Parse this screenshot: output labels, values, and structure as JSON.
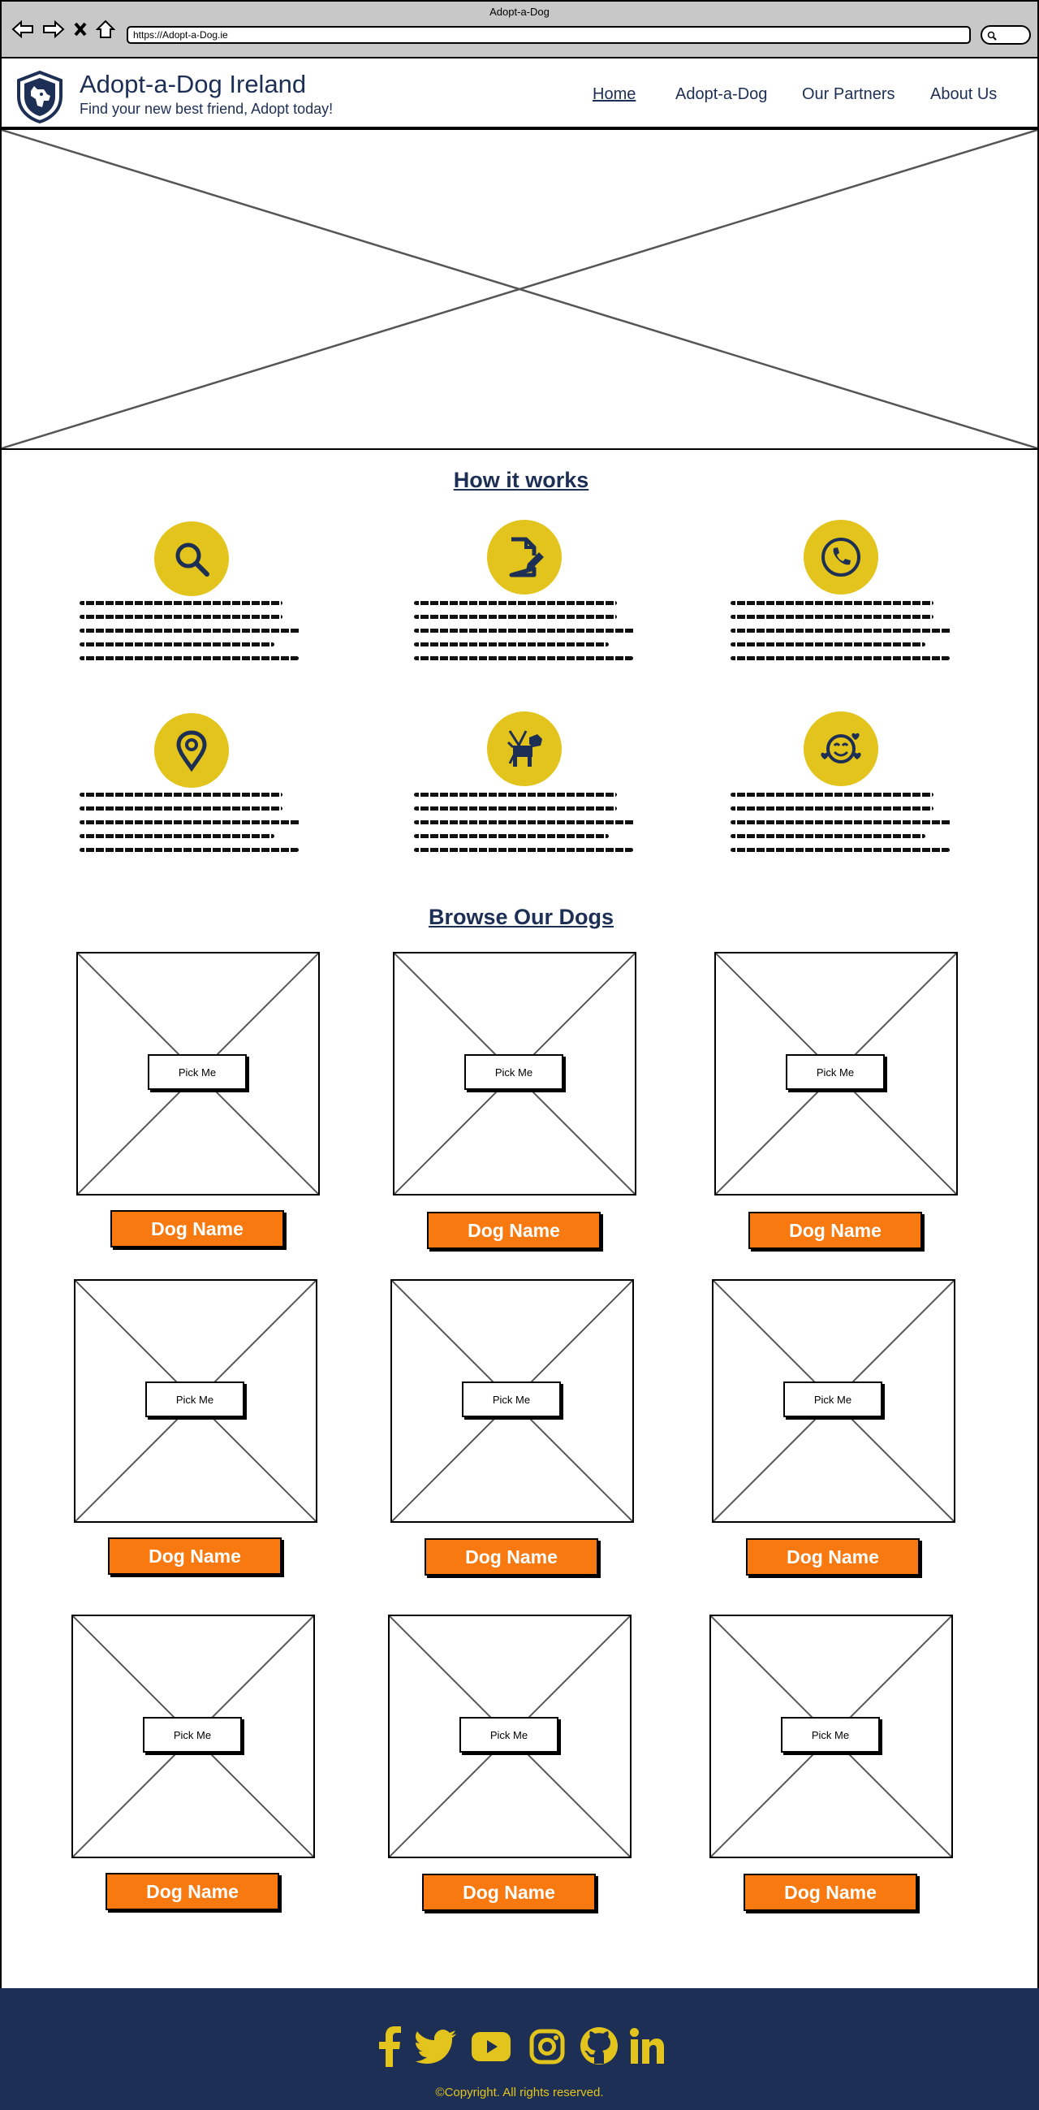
{
  "browser": {
    "window_title": "Adopt-a-Dog",
    "url": "https://Adopt-a-Dog.ie"
  },
  "header": {
    "title": "Adopt-a-Dog Ireland",
    "tagline": "Find your new best friend, Adopt today!",
    "nav": [
      "Home",
      "Adopt-a-Dog",
      "Our Partners",
      "About Us"
    ],
    "active_nav": "Home"
  },
  "how_it_works": {
    "title": "How it works",
    "steps": [
      {
        "icon": "search-icon"
      },
      {
        "icon": "document-edit-icon"
      },
      {
        "icon": "phone-icon"
      },
      {
        "icon": "location-pin-icon"
      },
      {
        "icon": "dog-icon"
      },
      {
        "icon": "smiley-hearts-icon"
      }
    ]
  },
  "browse": {
    "title": "Browse Our Dogs",
    "pick_label": "Pick Me",
    "dogs": [
      {
        "name": "Dog Name"
      },
      {
        "name": "Dog Name"
      },
      {
        "name": "Dog Name"
      },
      {
        "name": "Dog Name"
      },
      {
        "name": "Dog Name"
      },
      {
        "name": "Dog Name"
      },
      {
        "name": "Dog Name"
      },
      {
        "name": "Dog Name"
      },
      {
        "name": "Dog Name"
      }
    ]
  },
  "footer": {
    "social": [
      "facebook-icon",
      "twitter-icon",
      "youtube-icon",
      "instagram-icon",
      "github-icon",
      "linkedin-icon"
    ],
    "copyright": "©Copyright. All rights reserved."
  },
  "colors": {
    "navy": "#1d2f55",
    "yellow": "#e2c41c",
    "orange": "#f77910"
  }
}
